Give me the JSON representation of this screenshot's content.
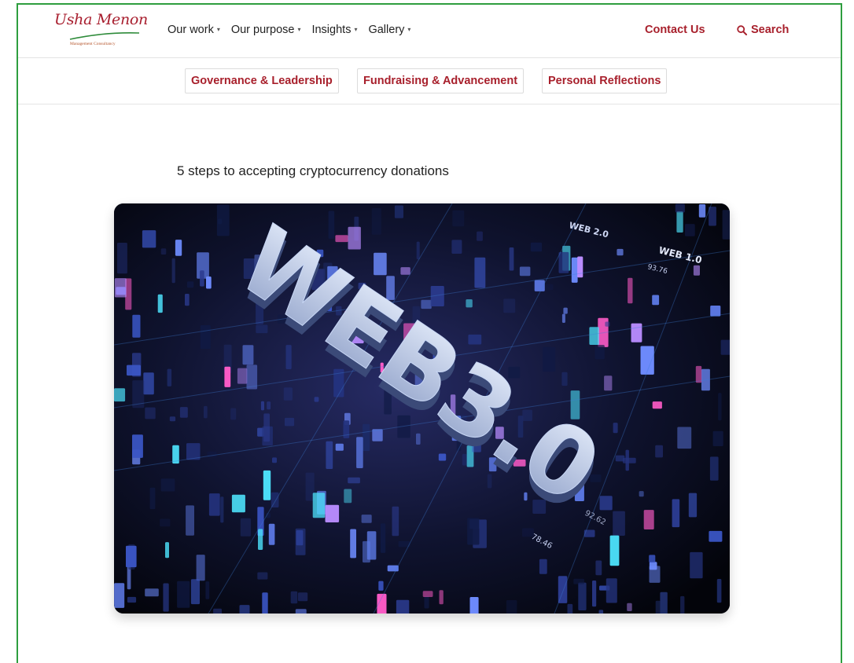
{
  "brand": {
    "logo_script": "Usha Menon",
    "logo_tagline": "Management Consultancy"
  },
  "nav": {
    "items": [
      {
        "label": "Our work"
      },
      {
        "label": "Our purpose"
      },
      {
        "label": "Insights"
      },
      {
        "label": "Gallery"
      }
    ],
    "contact_label": "Contact Us",
    "search_label": "Search"
  },
  "categories": [
    {
      "label": "Governance & Leadership"
    },
    {
      "label": "Fundraising & Advancement"
    },
    {
      "label": "Personal Reflections"
    }
  ],
  "article": {
    "title": "5 steps to accepting cryptocurrency donations",
    "hero_text": "WEB3.0",
    "hero_labels": {
      "web20": "WEB 2.0",
      "web10": "WEB 1.0",
      "n1": "93.76",
      "n2": "78.46",
      "n3": "92.62"
    }
  },
  "colors": {
    "accent": "#a8202c",
    "frame": "#2e9e3f",
    "text": "#222222"
  }
}
